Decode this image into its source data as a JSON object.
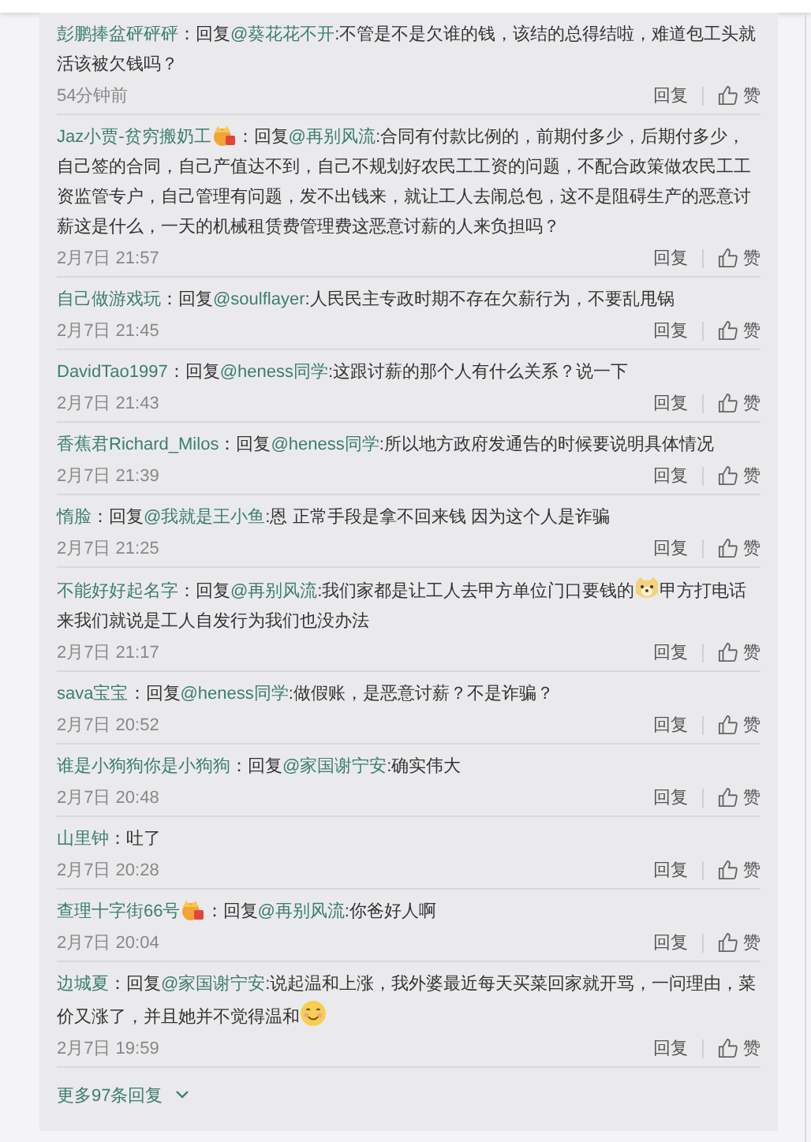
{
  "comments": [
    {
      "user": "彭鹏捧盆砰砰砰",
      "badge": false,
      "parts": [
        {
          "kind": "text",
          "text": "：回复"
        },
        {
          "kind": "mention",
          "text": "@葵花花不开"
        },
        {
          "kind": "text",
          "text": ":不管是不是欠谁的钱，该结的总得结啦，难道包工头就活该被欠钱吗？"
        }
      ],
      "time": "54分钟前",
      "reply": "回复",
      "like": "赞"
    },
    {
      "user": "Jaz小贾-贫穷搬奶工",
      "badge": true,
      "parts": [
        {
          "kind": "text",
          "text": "：回复"
        },
        {
          "kind": "mention",
          "text": "@再别风流"
        },
        {
          "kind": "text",
          "text": ":合同有付款比例的，前期付多少，后期付多少，自己签的合同，自己产值达不到，自己不规划好农民工工资的问题，不配合政策做农民工工资监管专户，自己管理有问题，发不出钱来，就让工人去闹总包，这不是阻碍生产的恶意讨薪这是什么，一天的机械租赁费管理费这恶意讨薪的人来负担吗？"
        }
      ],
      "time": "2月7日 21:57",
      "reply": "回复",
      "like": "赞"
    },
    {
      "user": "自己做游戏玩",
      "badge": false,
      "parts": [
        {
          "kind": "text",
          "text": "：回复"
        },
        {
          "kind": "mention",
          "text": "@soulflayer"
        },
        {
          "kind": "text",
          "text": ":人民民主专政时期不存在欠薪行为，不要乱甩锅"
        }
      ],
      "time": "2月7日 21:45",
      "reply": "回复",
      "like": "赞"
    },
    {
      "user": "DavidTao1997",
      "badge": false,
      "parts": [
        {
          "kind": "text",
          "text": "：回复"
        },
        {
          "kind": "mention",
          "text": "@heness同学"
        },
        {
          "kind": "text",
          "text": ":这跟讨薪的那个人有什么关系？说一下"
        }
      ],
      "time": "2月7日 21:43",
      "reply": "回复",
      "like": "赞"
    },
    {
      "user": "香蕉君Richard_Milos",
      "badge": false,
      "parts": [
        {
          "kind": "text",
          "text": "：回复"
        },
        {
          "kind": "mention",
          "text": "@heness同学"
        },
        {
          "kind": "text",
          "text": ":所以地方政府发通告的时候要说明具体情况"
        }
      ],
      "time": "2月7日 21:39",
      "reply": "回复",
      "like": "赞"
    },
    {
      "user": "惰脸",
      "badge": false,
      "parts": [
        {
          "kind": "text",
          "text": "：回复"
        },
        {
          "kind": "mention",
          "text": "@我就是王小鱼"
        },
        {
          "kind": "text",
          "text": ":恩 正常手段是拿不回来钱 因为这个人是诈骗"
        }
      ],
      "time": "2月7日 21:25",
      "reply": "回复",
      "like": "赞"
    },
    {
      "user": "不能好好起名字",
      "badge": false,
      "parts": [
        {
          "kind": "text",
          "text": "：回复"
        },
        {
          "kind": "mention",
          "text": "@再别风流"
        },
        {
          "kind": "text",
          "text": ":我们家都是让工人去甲方单位门口要钱的"
        },
        {
          "kind": "emoji-dog"
        },
        {
          "kind": "text",
          "text": "甲方打电话来我们就说是工人自发行为我们也没办法"
        }
      ],
      "time": "2月7日 21:17",
      "reply": "回复",
      "like": "赞"
    },
    {
      "user": "sava宝宝",
      "badge": false,
      "parts": [
        {
          "kind": "text",
          "text": "：回复"
        },
        {
          "kind": "mention",
          "text": "@heness同学"
        },
        {
          "kind": "text",
          "text": ":做假账，是恶意讨薪？不是诈骗？"
        }
      ],
      "time": "2月7日 20:52",
      "reply": "回复",
      "like": "赞"
    },
    {
      "user": "谁是小狗狗你是小狗狗",
      "badge": false,
      "parts": [
        {
          "kind": "text",
          "text": "：回复"
        },
        {
          "kind": "mention",
          "text": "@家国谢宁安"
        },
        {
          "kind": "text",
          "text": ":确实伟大"
        }
      ],
      "time": "2月7日 20:48",
      "reply": "回复",
      "like": "赞"
    },
    {
      "user": "山里钟",
      "badge": false,
      "parts": [
        {
          "kind": "text",
          "text": "：吐了"
        }
      ],
      "time": "2月7日 20:28",
      "reply": "回复",
      "like": "赞"
    },
    {
      "user": "查理十字街66号",
      "badge": true,
      "parts": [
        {
          "kind": "text",
          "text": "：回复"
        },
        {
          "kind": "mention",
          "text": "@再别风流"
        },
        {
          "kind": "text",
          "text": ":你爸好人啊"
        }
      ],
      "time": "2月7日 20:04",
      "reply": "回复",
      "like": "赞"
    },
    {
      "user": "边城夏",
      "badge": false,
      "parts": [
        {
          "kind": "text",
          "text": "：回复"
        },
        {
          "kind": "mention",
          "text": "@家国谢宁安"
        },
        {
          "kind": "text",
          "text": ":说起温和上涨，我外婆最近每天买菜回家就开骂，一问理由，菜价又涨了，并且她并不觉得温和"
        },
        {
          "kind": "emoji-smile"
        }
      ],
      "time": "2月7日 19:59",
      "reply": "回复",
      "like": "赞"
    }
  ],
  "more": {
    "label": "更多97条回复"
  }
}
